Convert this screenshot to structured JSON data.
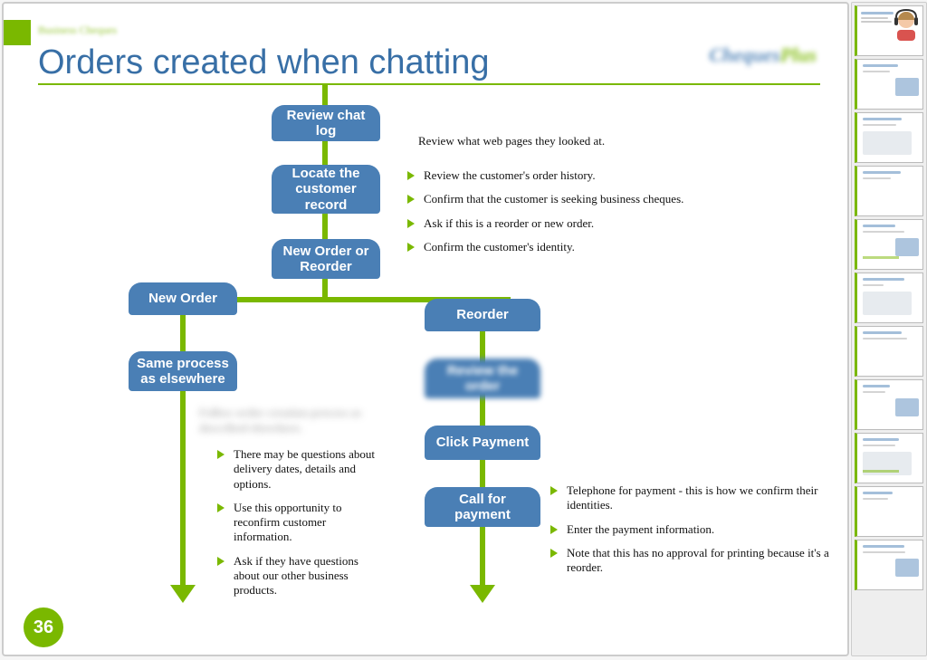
{
  "section_label": "Business Cheques",
  "title": "Orders created when chatting",
  "logo": {
    "brand": "Cheques",
    "suffix": "Plus"
  },
  "page_number": "36",
  "nodes": {
    "review_chat": "Review chat log",
    "locate": "Locate the\ncustomer\nrecord",
    "decision": "New Order or\nReorder",
    "new_order": "New Order",
    "same_process": "Same process\nas elsewhere",
    "reorder": "Reorder",
    "blurred_step": "Review the\norder",
    "click_payment": "Click Payment",
    "call_payment": "Call for\npayment"
  },
  "review_note": "Review what web pages they looked at.",
  "locate_bullets": [
    "Review the customer's order history.",
    "Confirm that the customer is seeking business cheques.",
    "Ask if this is a reorder or new order.",
    "Confirm the customer's identity."
  ],
  "new_order_blur": "Follow order creation process as described elsewhere.",
  "new_order_bullets": [
    "There may be questions about delivery dates, details and options.",
    "Use this opportunity to reconfirm customer information.",
    "Ask if they have questions about our other business products."
  ],
  "payment_bullets": [
    "Telephone for payment - this is how we confirm their identities.",
    "Enter the payment information.",
    "Note that this has no approval for printing because it's a reorder."
  ],
  "thumbnail_count": 11
}
